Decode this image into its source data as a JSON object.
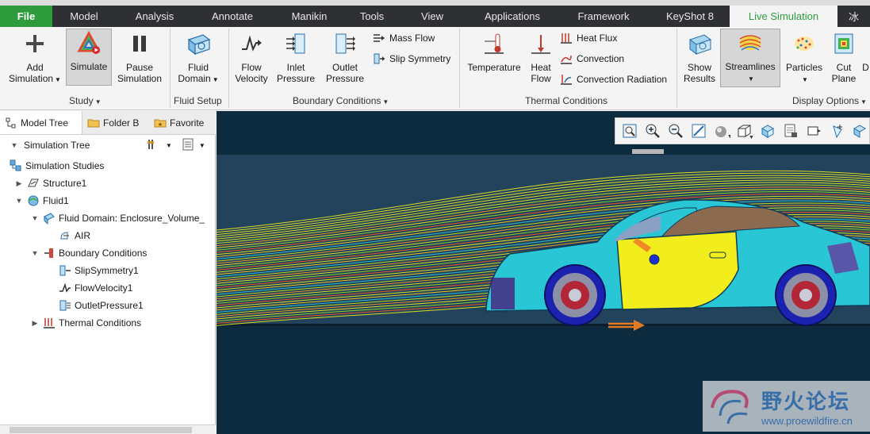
{
  "menu": {
    "tabs": [
      "File",
      "Model",
      "Analysis",
      "Annotate",
      "Manikin",
      "Tools",
      "View",
      "Applications",
      "Framework",
      "KeyShot 8",
      "Live Simulation",
      "冰"
    ],
    "active": "Live Simulation"
  },
  "ribbon": {
    "study": {
      "label": "Study",
      "add_simulation": "Add Simulation",
      "simulate": "Simulate",
      "pause_simulation": "Pause Simulation"
    },
    "fluid_setup": {
      "label": "Fluid Setup",
      "fluid_domain": "Fluid Domain"
    },
    "boundary_conditions": {
      "label": "Boundary Conditions",
      "flow_velocity": "Flow Velocity",
      "inlet_pressure": "Inlet Pressure",
      "outlet_pressure": "Outlet Pressure",
      "mass_flow": "Mass Flow",
      "slip_symmetry": "Slip Symmetry"
    },
    "thermal_conditions": {
      "label": "Thermal Conditions",
      "temperature": "Temperature",
      "heat_flow": "Heat Flow",
      "heat_flux": "Heat Flux",
      "convection": "Convection",
      "convection_radiation": "Convection Radiation"
    },
    "display_options": {
      "label": "Display Options",
      "show_results": "Show Results",
      "streamlines": "Streamlines",
      "particles": "Particles",
      "cut_plane": "Cut Plane",
      "more": "D"
    }
  },
  "panel": {
    "tabs": [
      "Model Tree",
      "Folder B",
      "Favorite"
    ],
    "tree_title": "Simulation Tree",
    "tree": [
      {
        "label": "Simulation Studies",
        "level": 0,
        "twisty": ""
      },
      {
        "label": "Structure1",
        "level": 1,
        "twisty": "▶"
      },
      {
        "label": "Fluid1",
        "level": 1,
        "twisty": "▼"
      },
      {
        "label": "Fluid Domain: Enclosure_Volume_",
        "level": 2,
        "twisty": "▼"
      },
      {
        "label": "AIR",
        "level": 3,
        "twisty": ""
      },
      {
        "label": "Boundary Conditions",
        "level": 2,
        "twisty": "▼"
      },
      {
        "label": "SlipSymmetry1",
        "level": 3,
        "twisty": ""
      },
      {
        "label": "FlowVelocity1",
        "level": 3,
        "twisty": ""
      },
      {
        "label": "OutletPressure1",
        "level": 3,
        "twisty": ""
      },
      {
        "label": "Thermal Conditions",
        "level": 2,
        "twisty": "▶"
      }
    ]
  },
  "watermark": {
    "title": "野火论坛",
    "url": "www.proewildfire.cn"
  },
  "colors": {
    "file_tab": "#2e9b3c",
    "menubar": "#2e3033",
    "viewport_bg": "#0d2b3f",
    "car_body": "#29c7d6",
    "door": "#f2ee1e"
  }
}
